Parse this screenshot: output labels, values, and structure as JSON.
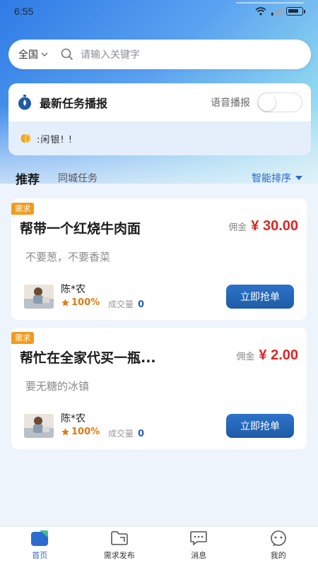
{
  "status": {
    "time": "6:55"
  },
  "search": {
    "region": "全国",
    "placeholder": "请输入关键字"
  },
  "broadcast": {
    "title": "最新任务播报",
    "voice_label": "语音播报",
    "voice_enabled": false,
    "ticker": ":闲银! !"
  },
  "tabs": {
    "active": "推荐",
    "other": "同城任务",
    "sort": "智能排序"
  },
  "tasks": [
    {
      "tag": "需求",
      "title": "帮带一个红烧牛肉面",
      "commission_label": "佣金",
      "price": "¥ 30.00",
      "desc": "不要葱，不要香菜",
      "user": "陈*农",
      "rating": "100%",
      "deals_label": "成交量",
      "deals": "0",
      "button": "立即抢单"
    },
    {
      "tag": "需求",
      "title": "帮忙在全家代买一瓶...",
      "commission_label": "佣金",
      "price": "¥ 2.00",
      "desc": "要无糖的冰镇",
      "user": "陈*农",
      "rating": "100%",
      "deals_label": "成交量",
      "deals": "0",
      "button": "立即抢单"
    }
  ],
  "nav": [
    {
      "label": "首页",
      "icon": "home-icon",
      "active": true
    },
    {
      "label": "需求发布",
      "icon": "folder-icon",
      "active": false
    },
    {
      "label": "消息",
      "icon": "message-icon",
      "active": false
    },
    {
      "label": "我的",
      "icon": "profile-icon",
      "active": false
    }
  ],
  "colors": {
    "accent": "#2c6bd1",
    "price": "#e02424",
    "tag": "#f39a1d",
    "button": "#1e5ca6"
  }
}
